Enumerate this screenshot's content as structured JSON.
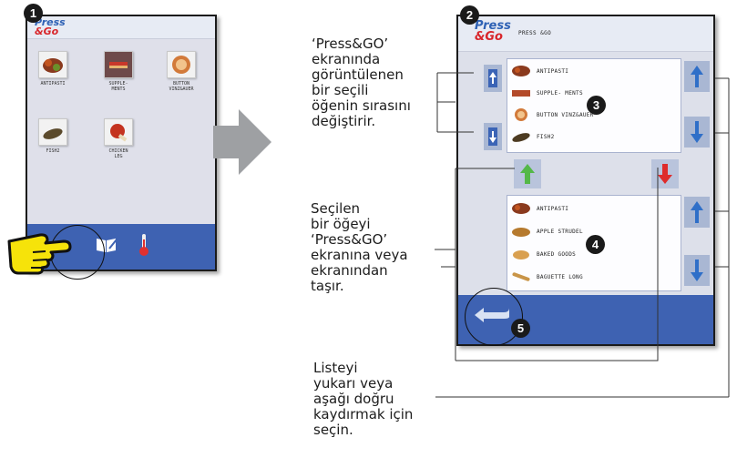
{
  "screen1": {
    "badge": "1",
    "logo_line1": "Press",
    "logo_line2": "&Go",
    "tiles": [
      {
        "label": "ANTIPASTI"
      },
      {
        "label": "SUPPLE-\nMENTS"
      },
      {
        "label": "BUTTON\nVINZ&AUER"
      },
      {
        "label": "FISH2"
      },
      {
        "label": "CHICKEN\nLEG"
      }
    ],
    "icons": [
      "hand-pointer-icon",
      "book-edit-icon",
      "thermometer-icon"
    ]
  },
  "screen2": {
    "badge": "2",
    "logo_line1": "Press",
    "logo_line2": "&Go",
    "title": "PRESS &GO",
    "top_list": [
      "ANTIPASTI",
      "SUPPLE- MENTS",
      "BUTTON VINZ&AUER",
      "FISH2"
    ],
    "bottom_list": [
      "ANTIPASTI",
      "APPLE STRUDEL",
      "BAKED GOODS",
      "BAGUETTE LONG"
    ],
    "badge3": "3",
    "badge4": "4",
    "badge5": "5",
    "colors": {
      "up_arrow": "#2f6fc8",
      "green_arrow": "#54b848",
      "red_arrow": "#de2b2b",
      "bar": "#3e62b2"
    }
  },
  "callouts": {
    "c1": "‘Press&GO’\nekranında\ngörüntülenen\nbir seçili\nöğenin sırasını\ndeğiştirir.",
    "c2": "Seçilen\nbir öğeyi\n‘Press&GO’\nekranına veya\nekranından\ntaşır.",
    "c3": "Listeyi\nyukarı veya\naşağı doğru\nkaydırmak için\nseçin."
  }
}
